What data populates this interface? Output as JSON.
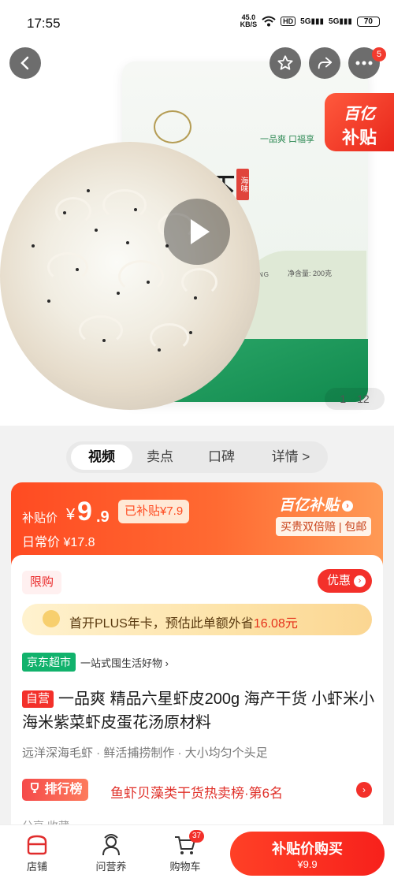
{
  "status_bar": {
    "time": "17:55",
    "net_speed_top": "45.0",
    "net_speed_unit": "KB/S",
    "hd": "HD",
    "signal1": "5G",
    "signal2": "5G",
    "battery": "70"
  },
  "hero": {
    "badge_line1": "百亿",
    "badge_line2": "补贴",
    "pager_current": "1",
    "pager_total": "12",
    "bag_slogan": "一品爽 口福享",
    "bag_char": "虾",
    "bag_side": "海味",
    "bag_weight": "净含量: 200克",
    "bag_brand": "NSHUANG"
  },
  "nav": {
    "more_badge": "5"
  },
  "tabs": [
    "视频",
    "卖点",
    "口碑",
    "详情 >"
  ],
  "price": {
    "subsidy_label": "补贴价",
    "currency": "¥",
    "price_int": "9",
    "price_dec": ".9",
    "subsidized_pill": "已补贴¥7.9",
    "daily_label": "日常价",
    "daily_value": "¥17.8",
    "program_name": "百亿补贴",
    "guarantee": "买贵双倍赔 | 包邮"
  },
  "card": {
    "limit_tag": "限购",
    "coupon_button": "优惠",
    "plus_text_pre": "首开PLUS年卡，预估此单额外省",
    "plus_amount": "16.08元",
    "store_tag": "京东超市",
    "store_sub": "一站式囤生活好物 ›",
    "self_tag": "自营",
    "title": "一品爽 精品六星虾皮200g 海产干货 小虾米小海米紫菜虾皮蛋花汤原材料",
    "features": "远洋深海毛虾 · 鲜活捕捞制作 · 大小均匀个头足",
    "rank_tag": "排行榜",
    "rank_text": "鱼虾贝藻类干货热卖榜·第6名",
    "peek_text": "分享              收藏"
  },
  "bottom_bar": {
    "store": "店铺",
    "service": "问营养",
    "cart": "购物车",
    "cart_count": "37",
    "buy_line1": "补贴价购买",
    "buy_line2": "¥9.9"
  }
}
